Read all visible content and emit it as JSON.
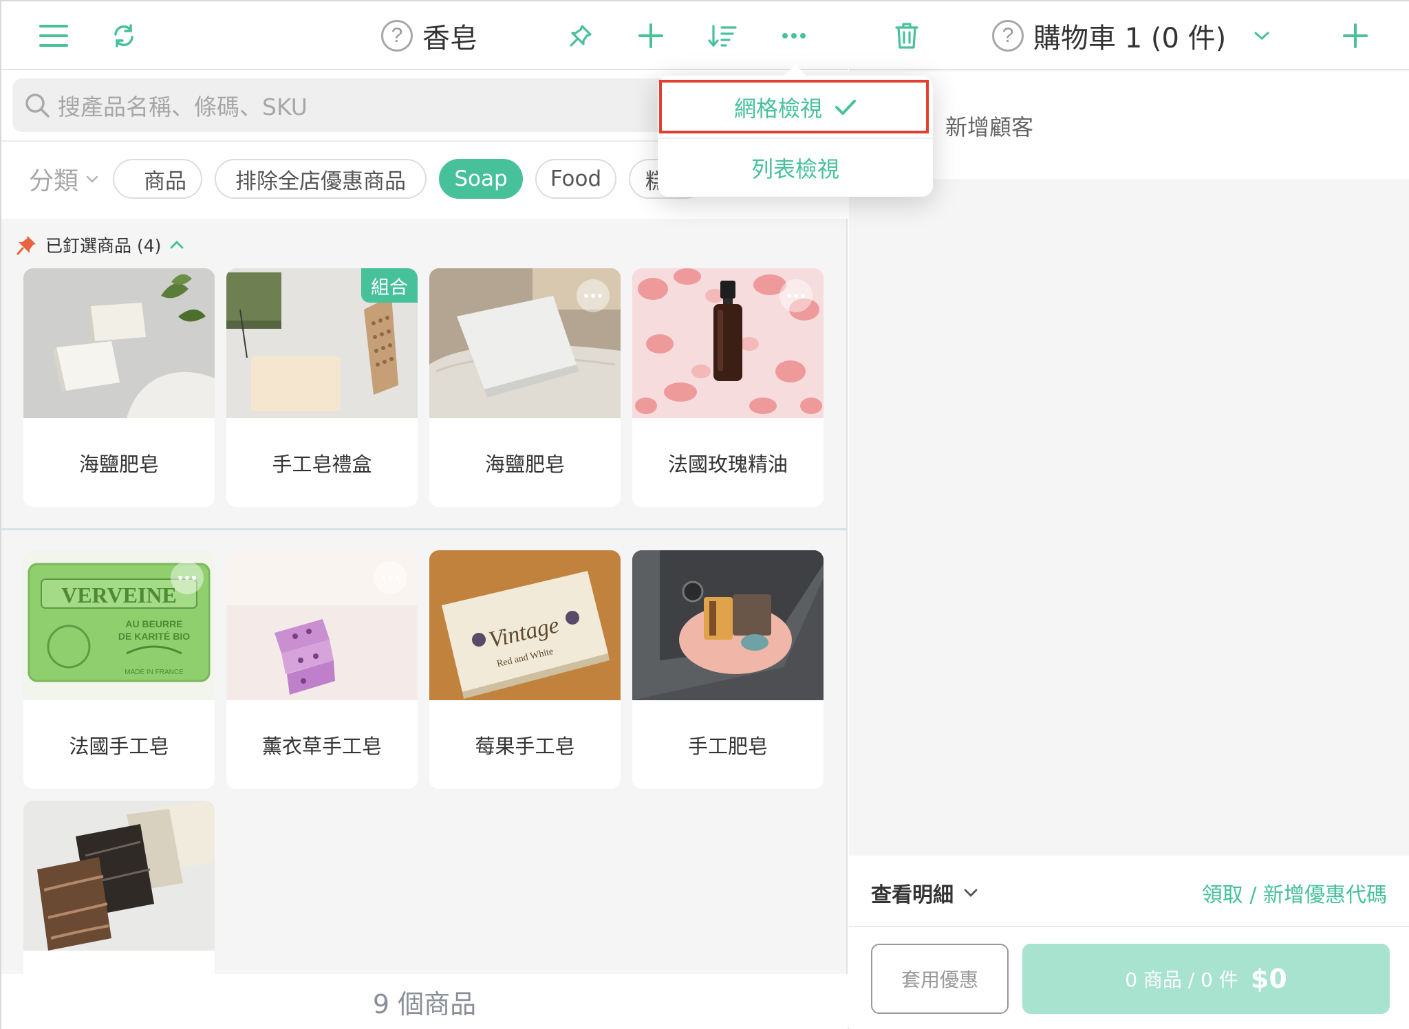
{
  "left_header": {
    "title": "香皂",
    "help_glyph": "?",
    "icons": [
      "menu-icon",
      "refresh-icon",
      "pin-icon",
      "plus-icon",
      "sort-icon",
      "more-icon"
    ]
  },
  "search": {
    "placeholder": "搜產品名稱、條碼、SKU"
  },
  "filters": {
    "category_label": "分類",
    "chips": [
      {
        "label": "商品",
        "active": false
      },
      {
        "label": "排除全店優惠商品",
        "active": false
      },
      {
        "label": "Soap",
        "active": true
      },
      {
        "label": "Food",
        "active": false
      },
      {
        "label": "糕",
        "active": false
      }
    ]
  },
  "pinned": {
    "label": "已釘選商品 (4)"
  },
  "pinned_products": [
    {
      "name": "海鹽肥皂",
      "badge": "",
      "has_menu": false
    },
    {
      "name": "手工皂禮盒",
      "badge": "組合",
      "has_menu": false
    },
    {
      "name": "海鹽肥皂",
      "badge": "",
      "has_menu": true
    },
    {
      "name": "法國玫瑰精油",
      "badge": "",
      "has_menu": true
    }
  ],
  "products": [
    {
      "name": "法國手工皂",
      "has_menu": true
    },
    {
      "name": "薰衣草手工皂",
      "has_menu": true
    },
    {
      "name": "莓果手工皂",
      "has_menu": false
    },
    {
      "name": "手工肥皂",
      "has_menu": false
    },
    {
      "name": "",
      "has_menu": false
    }
  ],
  "product_count": "9 個商品",
  "view_menu": {
    "grid_label": "網格檢視",
    "list_label": "列表檢視",
    "selected": "grid"
  },
  "cart": {
    "title": "購物車 1 (0 件)",
    "help_glyph": "?",
    "add_customer": "新增顧客",
    "view_details": "查看明細",
    "coupon_link": "領取 / 新增優惠代碼",
    "apply_coupon": "套用優惠",
    "checkout_count": "0 商品 / 0 件",
    "checkout_amount": "$0"
  },
  "colors": {
    "accent": "#46c19a",
    "accent_light": "#a8e3cf",
    "highlight": "#e53d2f",
    "pin_icon": "#e8633f"
  }
}
